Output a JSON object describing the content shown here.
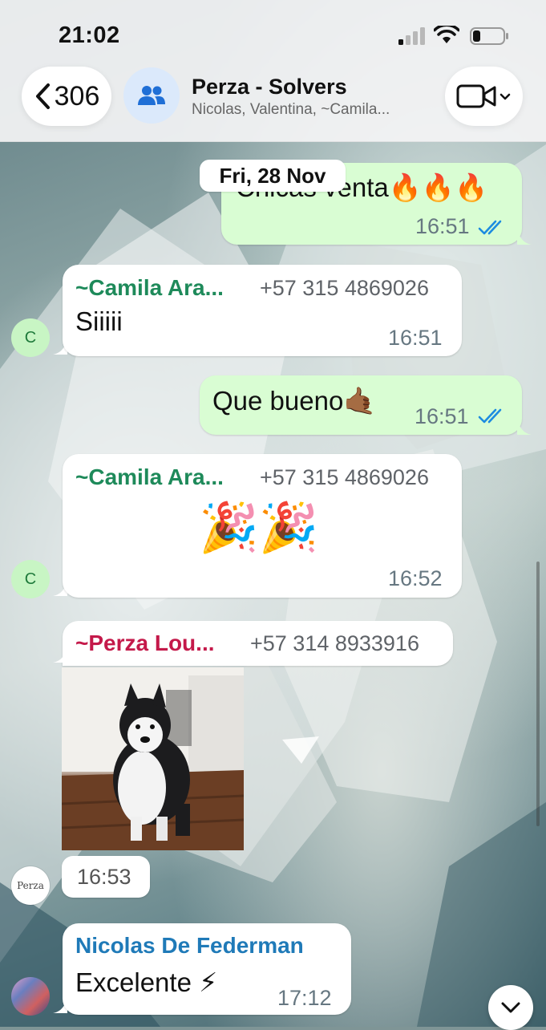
{
  "status_bar": {
    "time": "21:02"
  },
  "header": {
    "back_count": "306",
    "group_name": "Perza - Solvers",
    "members": "Nicolas, Valentina, ~Camila..."
  },
  "date_separator": "Fri, 28 Nov",
  "messages": [
    {
      "direction": "out",
      "text": "Chicas venta🔥🔥🔥",
      "time": "16:51",
      "status": "read"
    },
    {
      "direction": "in",
      "sender": "~Camila Ara...",
      "phone": "+57 315 4869026",
      "text": "Siiiii",
      "time": "16:51",
      "avatar": "C"
    },
    {
      "direction": "out",
      "text": "Que bueno🤙🏾",
      "time": "16:51",
      "status": "read"
    },
    {
      "direction": "in",
      "sender": "~Camila Ara...",
      "phone": "+57 315 4869026",
      "text": "🎉🎉",
      "time": "16:52",
      "avatar": "C"
    },
    {
      "direction": "in",
      "sender": "~Perza Lou...",
      "phone": "+57 314 8933916",
      "media": "husky-gif",
      "time": "16:53",
      "avatar": "Perza"
    },
    {
      "direction": "in",
      "sender": "Nicolas De Federman",
      "text": "Excelente ⚡",
      "time": "17:12",
      "avatar": "photo"
    }
  ],
  "colors": {
    "out_bubble": "#d9fdd3",
    "in_bubble": "#ffffff",
    "camila_name": "#1e8a5a",
    "perza_name": "#c4194a",
    "nicolas_name": "#1f7ab8",
    "read_ticks": "#1d8ce0"
  },
  "icons": {
    "back": "chevron-left-icon",
    "group": "group-icon",
    "video": "video-camera-icon",
    "scroll_down": "chevron-down-icon"
  }
}
